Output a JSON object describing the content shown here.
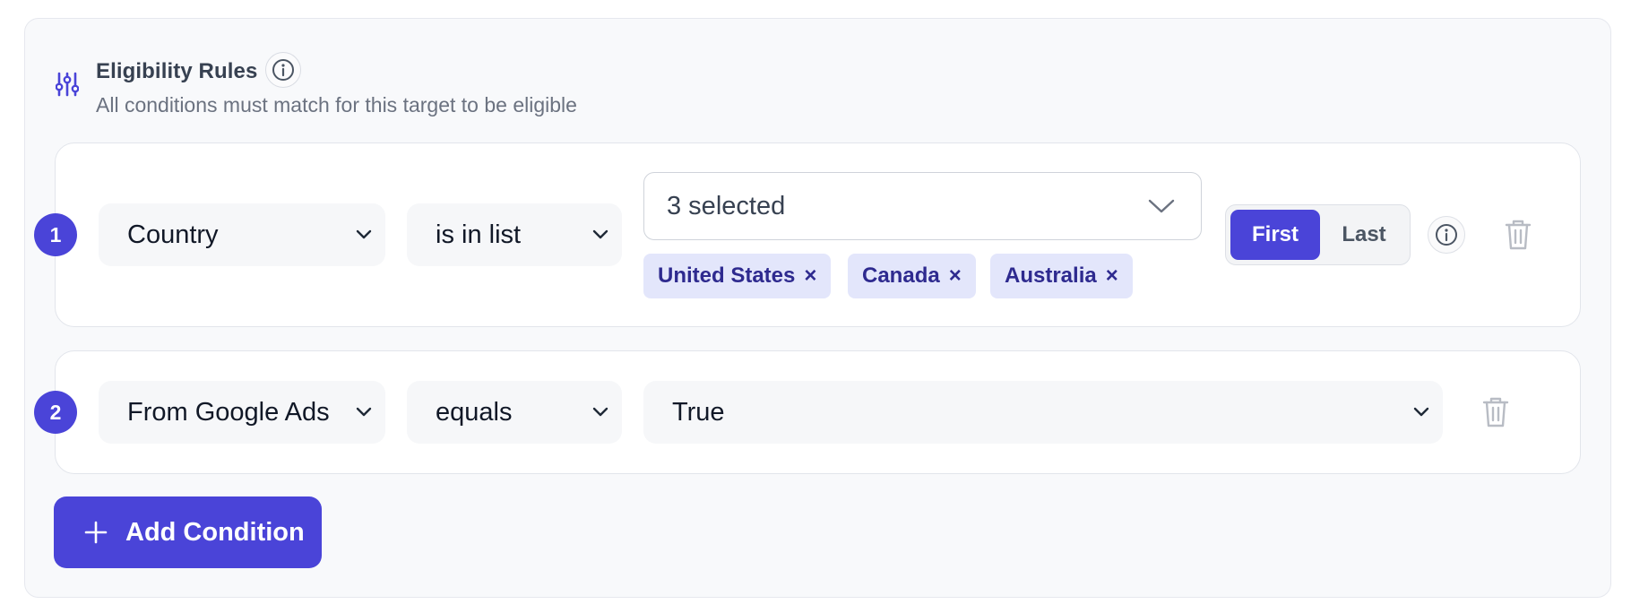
{
  "section": {
    "icon": "sliders-icon",
    "title": "Eligibility Rules",
    "subtitle": "All conditions must match for this target to be eligible",
    "info_icon": "info-icon"
  },
  "rules": [
    {
      "number": "1",
      "field": "Country",
      "operator": "is in list",
      "value_summary": "3 selected",
      "chips": [
        "United States",
        "Canada",
        "Australia"
      ],
      "chip_remove": "×",
      "match_toggle": {
        "options": [
          "First",
          "Last"
        ],
        "selected": "First"
      }
    },
    {
      "number": "2",
      "field": "From Google Ads",
      "operator": "equals",
      "value": "True"
    }
  ],
  "add_condition_label": "Add Condition",
  "colors": {
    "accent": "#4a44d8",
    "chip_bg": "#e3e6fb",
    "chip_text": "#2e2a8f",
    "panel_bg": "#f8f9fb"
  }
}
